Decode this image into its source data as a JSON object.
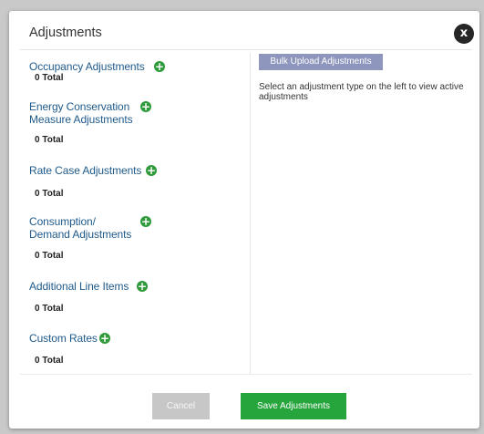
{
  "modal": {
    "title": "Adjustments",
    "close_label": "x"
  },
  "adjustments": [
    {
      "title_lines": [
        "Occupancy Adjustments"
      ],
      "total": "0 Total"
    },
    {
      "title_lines": [
        "Energy Conservation",
        "Measure Adjustments"
      ],
      "total": "0 Total"
    },
    {
      "title_lines": [
        "Rate Case Adjustments"
      ],
      "total": "0 Total"
    },
    {
      "title_lines": [
        "Consumption/",
        "Demand Adjustments"
      ],
      "total": "0 Total"
    },
    {
      "title_lines": [
        "Additional Line Items"
      ],
      "total": "0 Total"
    },
    {
      "title_lines": [
        "Custom Rates"
      ],
      "total": "0 Total"
    }
  ],
  "right_panel": {
    "bulk_upload_label": "Bulk Upload Adjustments",
    "help_text": "Select an adjustment type on the left to view active adjustments"
  },
  "footer": {
    "cancel_label": "Cancel",
    "save_label": "Save Adjustments"
  },
  "colors": {
    "link": "#1f5a8b",
    "add_icon": "#2e9a3a",
    "bulk_button": "#8e96bd",
    "save_button": "#27a53d",
    "cancel_button": "#c7c7c7"
  }
}
